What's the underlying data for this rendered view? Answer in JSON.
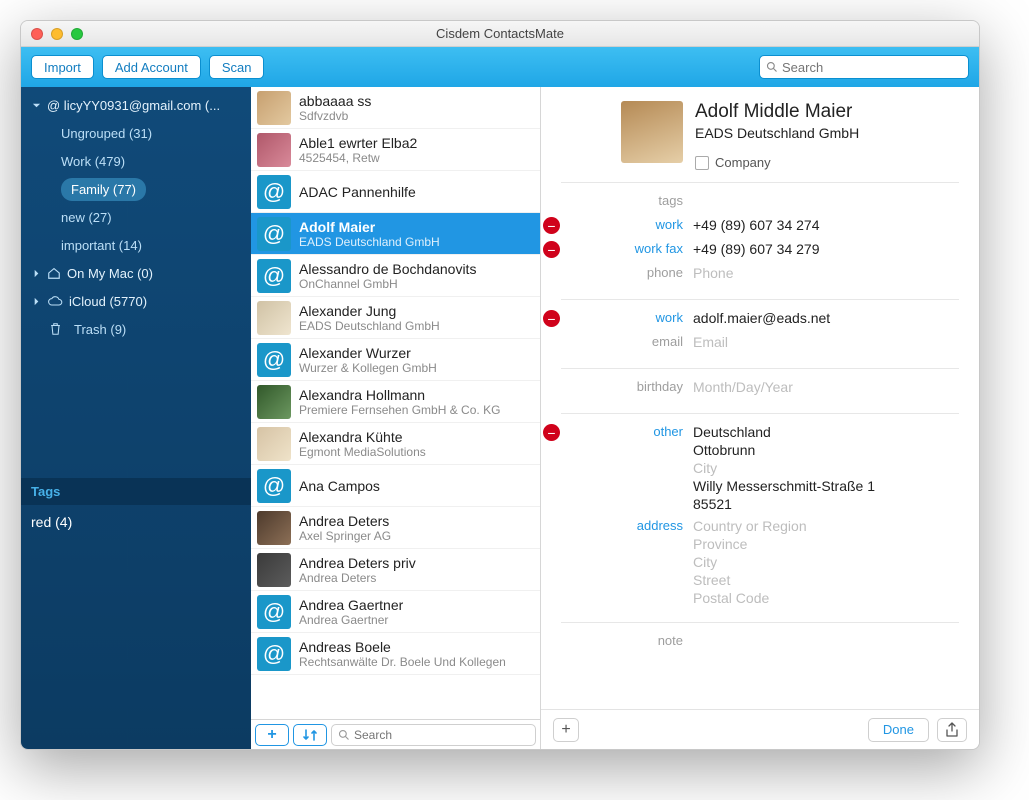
{
  "window": {
    "title": "Cisdem ContactsMate"
  },
  "toolbar": {
    "import": "Import",
    "add_account": "Add Account",
    "scan": "Scan",
    "search_placeholder": "Search"
  },
  "sidebar": {
    "accounts": [
      {
        "label": "@ licyYY0931@gmail.com (...",
        "expanded": true,
        "children": [
          {
            "label": "Ungrouped (31)"
          },
          {
            "label": "Work (479)"
          },
          {
            "label": "Family (77)",
            "active": true
          },
          {
            "label": "new (27)"
          },
          {
            "label": "important (14)"
          }
        ]
      },
      {
        "icon": "home",
        "label": "On My Mac (0)",
        "expanded": false
      },
      {
        "icon": "cloud",
        "label": "iCloud (5770)",
        "expanded": false
      }
    ],
    "trash": "Trash (9)",
    "tags_header": "Tags",
    "tags": [
      {
        "label": "red (4)"
      }
    ]
  },
  "contacts": [
    {
      "name": "abbaaaa ss",
      "sub": "Sdfvzdvb",
      "avatarStyle": "photo1"
    },
    {
      "name": "Able1 ewrter Elba2",
      "sub": "4525454, Retw",
      "avatarStyle": "photo2"
    },
    {
      "name": "ADAC Pannenhilfe",
      "sub": "",
      "avatarStyle": "at"
    },
    {
      "name": "Adolf Maier",
      "sub": "EADS Deutschland GmbH",
      "selected": true,
      "avatarStyle": "at"
    },
    {
      "name": "Alessandro de Bochdanovits",
      "sub": "OnChannel GmbH",
      "avatarStyle": "at"
    },
    {
      "name": "Alexander Jung",
      "sub": "EADS Deutschland GmbH",
      "avatarStyle": "photo3"
    },
    {
      "name": "Alexander Wurzer",
      "sub": "Wurzer & Kollegen GmbH",
      "avatarStyle": "at"
    },
    {
      "name": "Alexandra Hollmann",
      "sub": "Premiere Fernsehen GmbH & Co. KG",
      "avatarStyle": "photo4"
    },
    {
      "name": "Alexandra Kühte",
      "sub": "Egmont MediaSolutions",
      "avatarStyle": "photo5"
    },
    {
      "name": "Ana Campos",
      "sub": "",
      "avatarStyle": "at"
    },
    {
      "name": "Andrea Deters",
      "sub": "Axel Springer AG",
      "avatarStyle": "photo6"
    },
    {
      "name": "Andrea Deters priv",
      "sub": "Andrea Deters",
      "avatarStyle": "photo7"
    },
    {
      "name": "Andrea Gaertner",
      "sub": "Andrea Gaertner",
      "avatarStyle": "at"
    },
    {
      "name": "Andreas Boele",
      "sub": "Rechtsanwälte Dr. Boele Und Kollegen",
      "avatarStyle": "at"
    }
  ],
  "middle_footer": {
    "search_placeholder": "Search"
  },
  "detail": {
    "first": "Adolf",
    "middle": "Middle",
    "last": "Maier",
    "company": "EADS Deutschland GmbH",
    "company_checkbox": "Company",
    "tags_label": "tags",
    "fields": [
      {
        "label": "work",
        "value": "+49 (89) 607 34 274",
        "removable": true
      },
      {
        "label": "work fax",
        "value": "+49 (89) 607 34 279",
        "removable": true
      },
      {
        "label": "phone",
        "value": "Phone",
        "placeholder": true
      }
    ],
    "emails": [
      {
        "label": "work",
        "value": "adolf.maier@eads.net",
        "removable": true
      },
      {
        "label": "email",
        "value": "Email",
        "placeholder": true
      }
    ],
    "birthday": {
      "label": "birthday",
      "value": "Month/Day/Year",
      "placeholder": true
    },
    "addresses": [
      {
        "label": "other",
        "removable": true,
        "lines": [
          "Deutschland",
          "Ottobrunn",
          "City",
          "Willy Messerschmitt-Straße 1",
          "85521"
        ],
        "ph": [
          false,
          false,
          true,
          false,
          false
        ]
      },
      {
        "label": "address",
        "lines": [
          "Country or Region",
          "Province",
          "City",
          "Street",
          "Postal Code"
        ],
        "ph": [
          true,
          true,
          true,
          true,
          true
        ]
      }
    ],
    "note_label": "note"
  },
  "footer": {
    "done": "Done"
  }
}
